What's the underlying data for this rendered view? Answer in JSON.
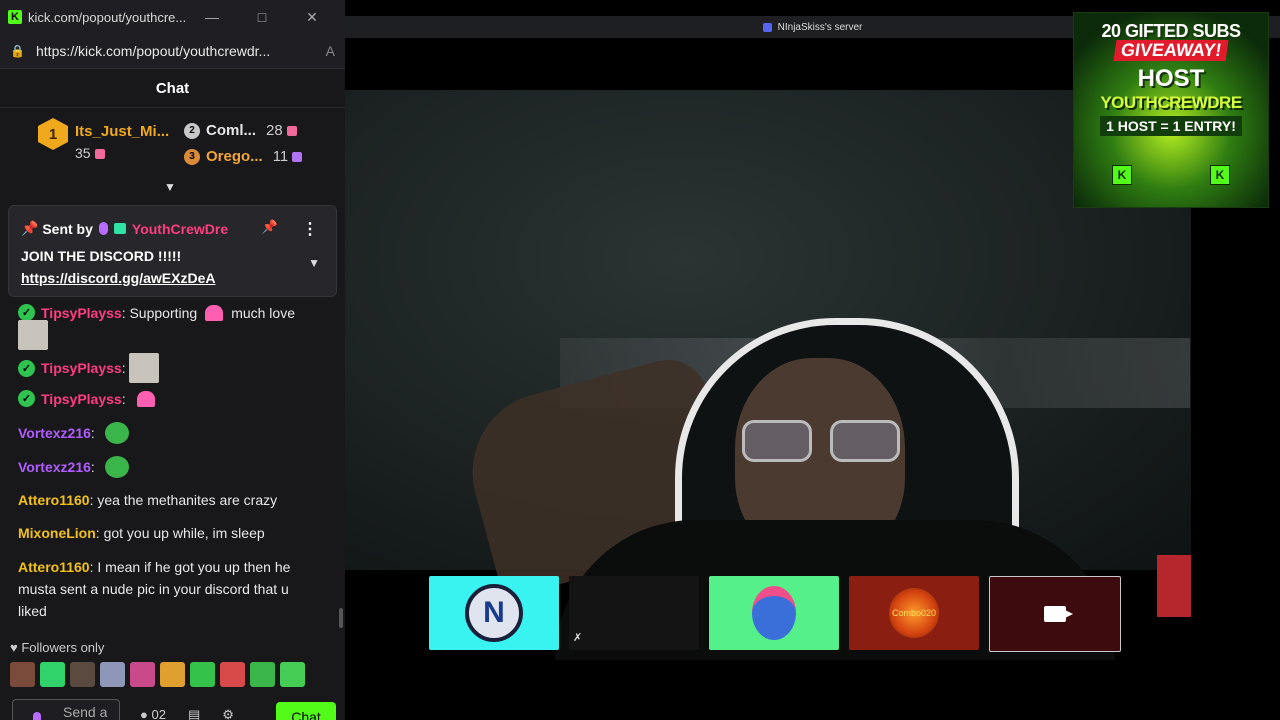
{
  "browser": {
    "tab_title": "kick.com/popout/youthcre...",
    "url": "https://kick.com/popout/youthcrewdr...",
    "favicon": "K",
    "reader_icon": "A"
  },
  "chat": {
    "header": "Chat",
    "leaderboard": {
      "first": {
        "rank": "1",
        "name": "Its_Just_Mi...",
        "count": "35"
      },
      "second": {
        "rank": "2",
        "name": "Coml...",
        "count": "28"
      },
      "third": {
        "rank": "3",
        "name": "Orego...",
        "count": "11"
      }
    },
    "pinned": {
      "sent_by": "Sent by",
      "author": "YouthCrewDre",
      "message": "JOIN THE DISCORD !!!!!",
      "link": "https://discord.gg/awEXzDeA"
    },
    "messages": [
      {
        "user": "TipsyPlayss",
        "text": "Supporting",
        "text2": "much love"
      },
      {
        "user": "TipsyPlayss",
        "text": ""
      },
      {
        "user": "TipsyPlayss",
        "text": ""
      },
      {
        "user": "Vortexz216",
        "text": ""
      },
      {
        "user": "Vortexz216",
        "text": ""
      },
      {
        "user": "Attero1160",
        "text": "yea the methanites are crazy"
      },
      {
        "user": "MixoneLion",
        "text": "got you up while, im sleep"
      },
      {
        "user": "Attero1160",
        "text": "I mean if he got you up then he",
        "line2": "musta sent a nude pic in your discord that u",
        "line3": "liked"
      }
    ],
    "followers_only": "Followers only",
    "input_placeholder": "Send a",
    "viewer_count": "02",
    "send_button": "Chat"
  },
  "discord": {
    "server_title": "NInjaSkiss's server",
    "tiles": [
      "",
      "",
      "",
      "Combo020",
      ""
    ]
  },
  "overlay": {
    "line1": "20 GIFTED SUBS",
    "line2": "GIVEAWAY!",
    "line3": "HOST",
    "line4": "YOUTHCREWDRE",
    "line5": "1 HOST = 1 ENTRY!",
    "badge": "K"
  },
  "colors": {
    "kick_green": "#53fc18",
    "username_pink": "#ff3d7f",
    "username_purple": "#b05cff",
    "username_gold": "#f3c21a"
  }
}
